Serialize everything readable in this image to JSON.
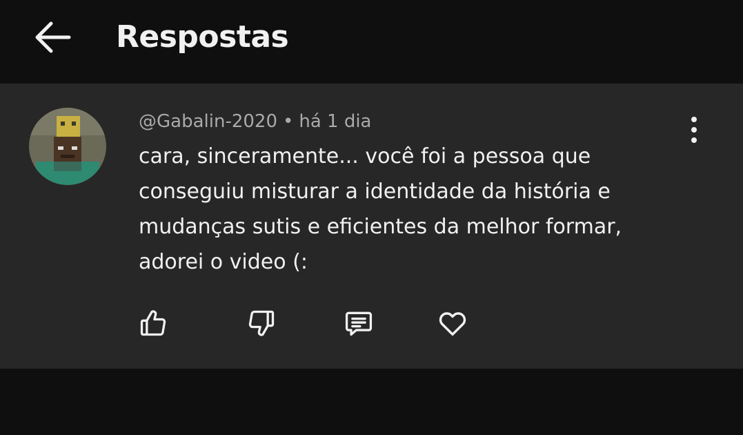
{
  "header": {
    "title": "Respostas",
    "back_icon": "arrow-left-icon"
  },
  "comment": {
    "author": "@Gabalin-2020",
    "separator": "•",
    "time": "há 1 dia",
    "text": "cara, sinceramente... você foi a pessoa que conseguiu misturar a identidade da história e mudanças sutis e eficientes da melhor formar, adorei o video (:",
    "avatar": "minecraft-character-avatar",
    "menu_icon": "more-vert-icon",
    "actions": {
      "like_icon": "thumbs-up-icon",
      "dislike_icon": "thumbs-down-icon",
      "reply_icon": "comment-icon",
      "heart_icon": "heart-icon"
    }
  },
  "colors": {
    "background": "#0f0f0f",
    "card": "#272727",
    "text_primary": "#f1f1f1",
    "text_secondary": "#aaaaaa"
  }
}
